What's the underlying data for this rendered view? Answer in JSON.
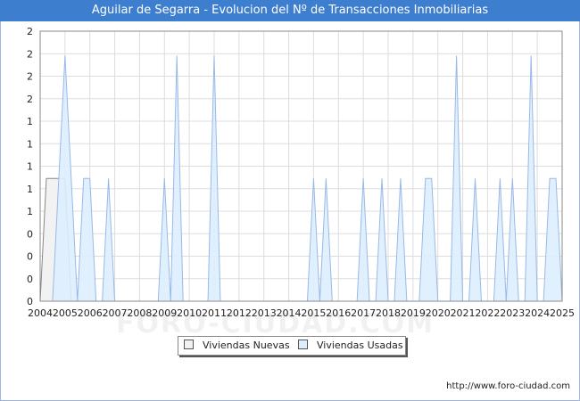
{
  "chart_data": {
    "type": "area",
    "title": "Aguilar de Segarra - Evolucion del Nº de Transacciones Inmobiliarias",
    "xlabel": "",
    "ylabel": "",
    "x_tick_labels": [
      "2004",
      "2005",
      "2006",
      "2007",
      "2008",
      "2009",
      "2010",
      "2011",
      "2012",
      "2013",
      "2014",
      "2015",
      "2016",
      "2017",
      "2018",
      "2019",
      "2020",
      "2021",
      "2022",
      "2023",
      "2024",
      "2025"
    ],
    "y_tick_labels": [
      "0",
      "0",
      "0",
      "1",
      "1",
      "1",
      "1",
      "1",
      "2",
      "2",
      "2",
      "2"
    ],
    "xlim": [
      2004,
      2025
    ],
    "ylim": [
      0,
      2.2
    ],
    "grid": true,
    "legend_position": "bottom-center",
    "series": [
      {
        "name": "Viviendas Nuevas",
        "color": "#f2f2f2",
        "stroke": "#888888",
        "points": [
          [
            2004.0,
            0
          ],
          [
            2004.25,
            1
          ],
          [
            2004.5,
            1
          ],
          [
            2004.75,
            1
          ],
          [
            2005.0,
            1
          ],
          [
            2005.25,
            0
          ]
        ]
      },
      {
        "name": "Viviendas Usadas",
        "color": "#ddeeff",
        "stroke": "#99b9e6",
        "points": [
          [
            2004.0,
            0
          ],
          [
            2004.5,
            0
          ],
          [
            2004.75,
            1
          ],
          [
            2005.0,
            2
          ],
          [
            2005.25,
            1
          ],
          [
            2005.5,
            0
          ],
          [
            2005.75,
            1
          ],
          [
            2006.0,
            1
          ],
          [
            2006.25,
            0
          ],
          [
            2006.5,
            0
          ],
          [
            2006.75,
            1
          ],
          [
            2007.0,
            0
          ],
          [
            2008.75,
            0
          ],
          [
            2009.0,
            1
          ],
          [
            2009.25,
            0
          ],
          [
            2009.5,
            2
          ],
          [
            2009.75,
            0
          ],
          [
            2010.75,
            0
          ],
          [
            2011.0,
            2
          ],
          [
            2011.25,
            0
          ],
          [
            2014.75,
            0
          ],
          [
            2015.0,
            1
          ],
          [
            2015.25,
            0
          ],
          [
            2015.5,
            1
          ],
          [
            2015.75,
            0
          ],
          [
            2016.75,
            0
          ],
          [
            2017.0,
            1
          ],
          [
            2017.25,
            0
          ],
          [
            2017.5,
            0
          ],
          [
            2017.75,
            1
          ],
          [
            2018.0,
            0
          ],
          [
            2018.25,
            0
          ],
          [
            2018.5,
            1
          ],
          [
            2018.75,
            0
          ],
          [
            2019.25,
            0
          ],
          [
            2019.5,
            1
          ],
          [
            2019.75,
            1
          ],
          [
            2020.0,
            0
          ],
          [
            2020.5,
            0
          ],
          [
            2020.75,
            2
          ],
          [
            2021.0,
            0
          ],
          [
            2021.25,
            0
          ],
          [
            2021.5,
            1
          ],
          [
            2021.75,
            0
          ],
          [
            2022.25,
            0
          ],
          [
            2022.5,
            1
          ],
          [
            2022.75,
            0
          ],
          [
            2022.75,
            0
          ],
          [
            2023.0,
            1
          ],
          [
            2023.25,
            0
          ],
          [
            2023.5,
            0
          ],
          [
            2023.75,
            2
          ],
          [
            2024.0,
            0
          ],
          [
            2024.25,
            0
          ],
          [
            2024.5,
            1
          ],
          [
            2024.75,
            1
          ],
          [
            2025.0,
            0
          ]
        ]
      }
    ]
  },
  "legend": {
    "items": [
      {
        "label": "Viviendas Nuevas",
        "color": "#f2f2f2"
      },
      {
        "label": "Viviendas Usadas",
        "color": "#ddeeff"
      }
    ]
  },
  "source_url": "http://www.foro-ciudad.com",
  "watermark": "FORO-CIUDAD.COM"
}
